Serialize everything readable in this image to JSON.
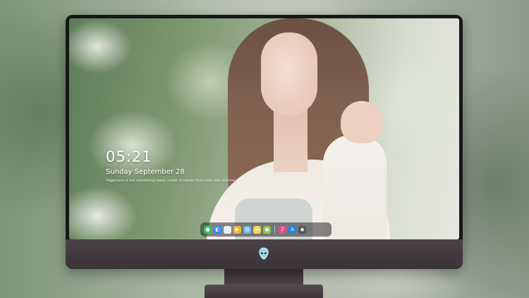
{
  "lock_screen": {
    "time": "05:21",
    "date": "Sunday September 28",
    "quote": "Happiness is not something ready made. It comes from your own actions."
  },
  "dock": {
    "items": [
      {
        "name": "messages-icon",
        "glyph": "●",
        "color": "#34c759"
      },
      {
        "name": "finder-icon",
        "glyph": "◧",
        "color": "#2d8cf0"
      },
      {
        "name": "safari-icon",
        "glyph": "✧",
        "color": "#e9eef5"
      },
      {
        "name": "clapper-icon",
        "glyph": "▶",
        "color": "#f4b63a"
      },
      {
        "name": "terminal-icon",
        "glyph": "▤",
        "color": "#6ab6e8"
      },
      {
        "name": "notes-icon",
        "glyph": "▬",
        "color": "#f6d34a"
      },
      {
        "name": "photos-icon",
        "glyph": "▣",
        "color": "#8bc34a"
      },
      {
        "name": "music-icon",
        "glyph": "♪",
        "color": "#e34f8c"
      },
      {
        "name": "app-store-icon",
        "glyph": "A",
        "color": "#1e88e5"
      },
      {
        "name": "camera-icon",
        "glyph": "◉",
        "color": "#555555"
      }
    ]
  },
  "monitor": {
    "logo": "alien-logo-icon"
  }
}
